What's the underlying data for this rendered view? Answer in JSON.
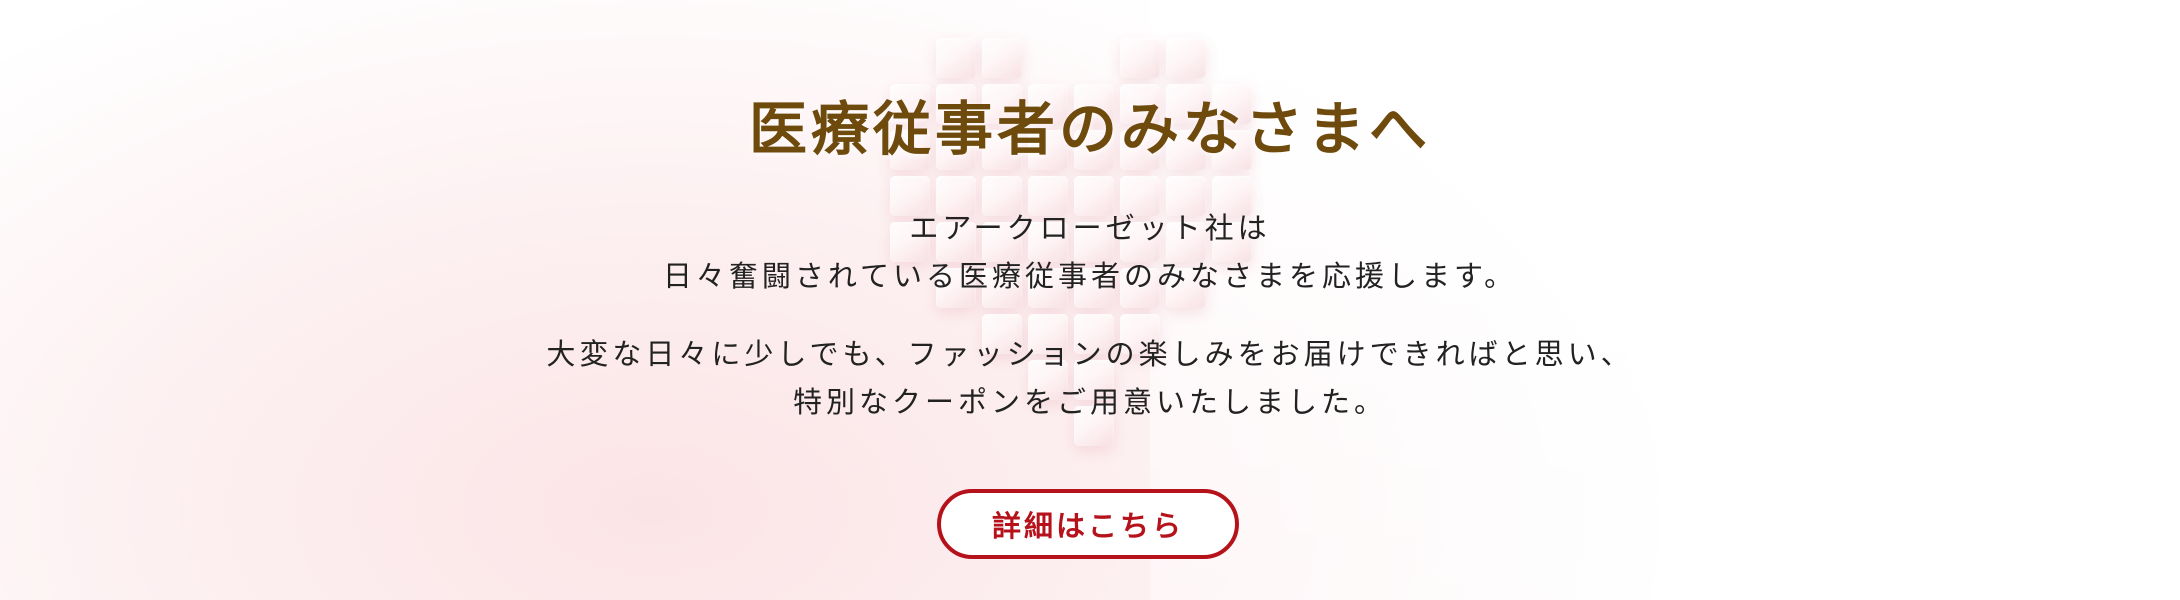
{
  "banner": {
    "headline": "医療従事者のみなさまへ",
    "intro": {
      "line1": "エアークローゼット社は",
      "line2": "日々奮闘されている医療従事者のみなさまを応援します。"
    },
    "message": {
      "line1": "大変な日々に少しでも、ファッションの楽しみをお届けできればと思い、",
      "line2": "特別なクーポンをご用意いたしました。"
    },
    "cta_label": "詳細はこちら"
  },
  "colors": {
    "headline": "#6e4a0c",
    "accent": "#b5121b",
    "body_text": "#222222",
    "background_tint": "#fbe4e6"
  },
  "icons": [
    "pixel-heart-decoration"
  ]
}
